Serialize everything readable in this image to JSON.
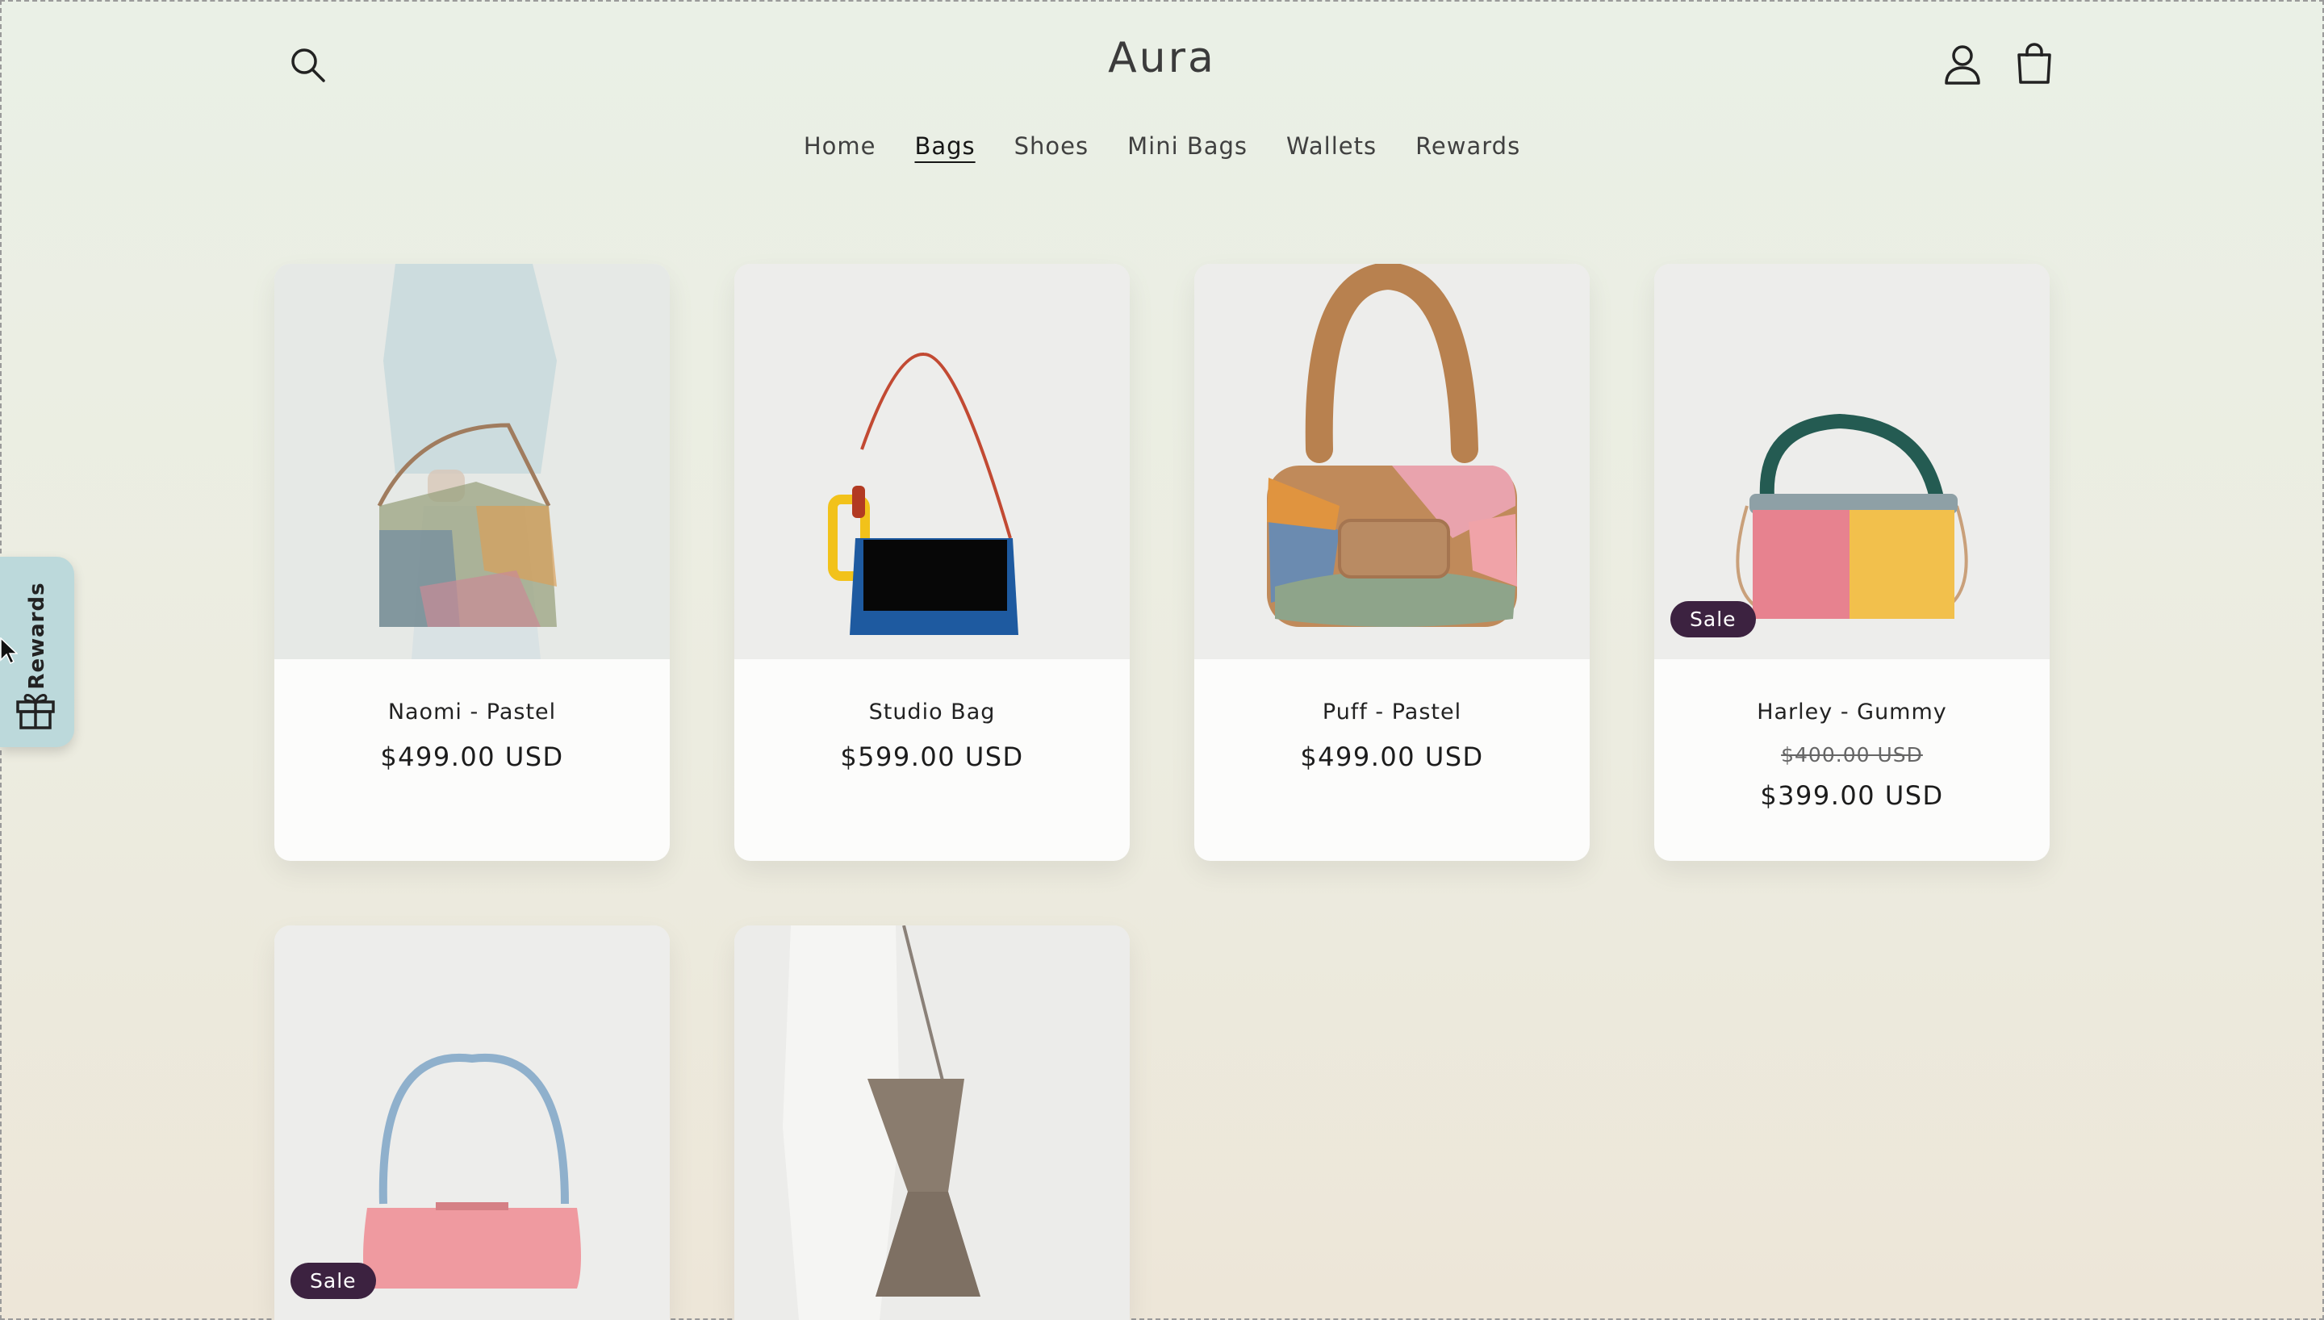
{
  "header": {
    "brand": "Aura",
    "icons": {
      "search": "search-icon",
      "account": "account-icon",
      "cart": "cart-icon"
    }
  },
  "nav": {
    "items": [
      {
        "label": "Home",
        "active": false
      },
      {
        "label": "Bags",
        "active": true
      },
      {
        "label": "Shoes",
        "active": false
      },
      {
        "label": "Mini Bags",
        "active": false
      },
      {
        "label": "Wallets",
        "active": false
      },
      {
        "label": "Rewards",
        "active": false
      }
    ]
  },
  "products": [
    {
      "title": "Naomi - Pastel",
      "price": "$499.00 USD"
    },
    {
      "title": "Studio Bag",
      "price": "$599.00 USD"
    },
    {
      "title": "Puff - Pastel",
      "price": "$499.00 USD"
    },
    {
      "title": "Harley - Gummy",
      "compare_price": "$400.00 USD",
      "price": "$399.00 USD",
      "badge": "Sale"
    },
    {
      "badge": "Sale"
    },
    {}
  ],
  "rewards_widget": {
    "label": "Rewards",
    "icon": "gift-icon"
  },
  "colors": {
    "sale_badge": "#3c2240",
    "rewards_tab": "#bcd9db"
  }
}
